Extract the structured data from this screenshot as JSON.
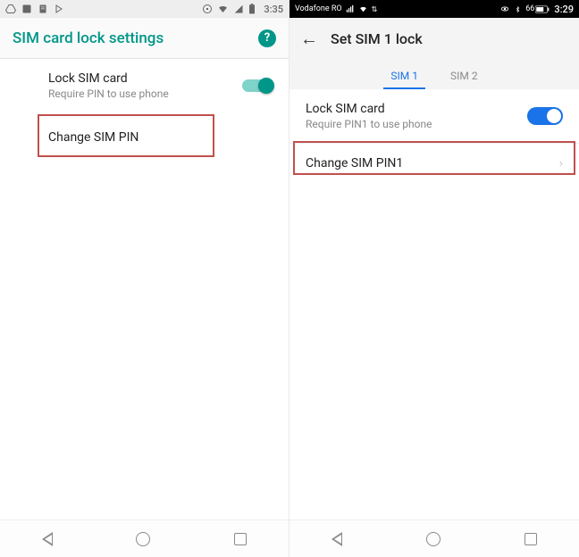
{
  "left": {
    "status": {
      "time": "3:35"
    },
    "header": {
      "title": "SIM card lock settings",
      "help_glyph": "?"
    },
    "lock": {
      "title": "Lock SIM card",
      "sub": "Require PIN to use phone"
    },
    "change": {
      "title": "Change SIM PIN"
    }
  },
  "right": {
    "status": {
      "carrier": "Vodafone RO",
      "time": "3:29",
      "battery": "66"
    },
    "header": {
      "title": "Set SIM 1 lock"
    },
    "tabs": {
      "sim1": "SIM 1",
      "sim2": "SIM 2"
    },
    "lock": {
      "title": "Lock SIM card",
      "sub": "Require PIN1 to use phone"
    },
    "change": {
      "title": "Change SIM PIN1"
    }
  }
}
